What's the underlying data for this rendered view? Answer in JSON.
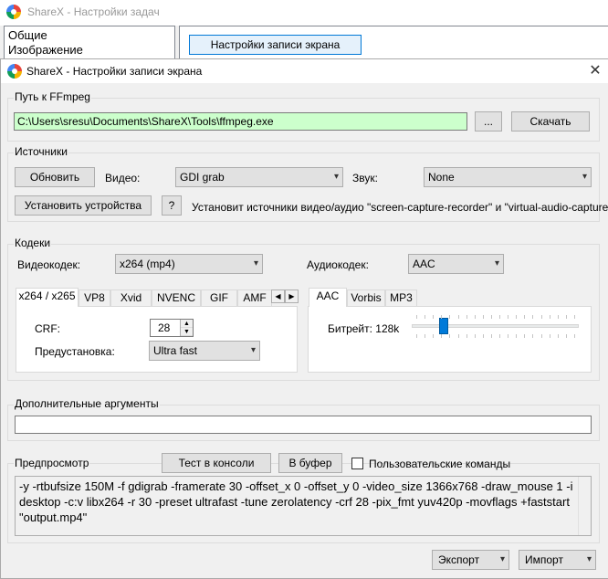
{
  "parent_window": {
    "title": "ShareX - Настройки задач",
    "sidebar_items": [
      "Общие",
      "Изображение"
    ],
    "screen_recording_button": "Настройки записи экрана"
  },
  "dialog": {
    "title": "ShareX - Настройки записи экрана",
    "close_glyph": "✕",
    "ffmpeg": {
      "group_label": "Путь к FFmpeg",
      "path_value": "C:\\Users\\sresu\\Documents\\ShareX\\Tools\\ffmpeg.exe",
      "browse_label": "...",
      "download_label": "Скачать"
    },
    "sources": {
      "group_label": "Источники",
      "refresh_label": "Обновить",
      "video_label": "Видео:",
      "video_value": "GDI grab",
      "audio_label": "Звук:",
      "audio_value": "None",
      "install_label": "Установить устройства",
      "help_label": "?",
      "install_hint": "Установит источники видео/аудио \"screen-capture-recorder\" и \"virtual-audio-capturer\""
    },
    "codecs": {
      "group_label": "Кодеки",
      "video_codec_label": "Видеокодек:",
      "video_codec_value": "x264 (mp4)",
      "audio_codec_label": "Аудиокодек:",
      "audio_codec_value": "AAC",
      "video_tabs": [
        "x264 / x265",
        "VP8",
        "Xvid",
        "NVENC",
        "GIF",
        "AMF"
      ],
      "audio_tabs": [
        "AAC",
        "Vorbis",
        "MP3"
      ],
      "crf_label": "CRF:",
      "crf_value": "28",
      "preset_label": "Предустановка:",
      "preset_value": "Ultra fast",
      "bitrate_label": "Битрейт: 128k",
      "bitrate_level": 0.19
    },
    "extra_args": {
      "group_label": "Дополнительные аргументы",
      "value": ""
    },
    "preview": {
      "group_label": "Предпросмотр",
      "test_console_label": "Тест в консоли",
      "to_clipboard_label": "В буфер",
      "custom_commands_label": "Пользовательские команды",
      "custom_commands_checked": false,
      "command_text": "-y -rtbufsize 150M -f gdigrab -framerate 30 -offset_x 0 -offset_y 0 -video_size 1366x768 -draw_mouse 1 -i desktop -c:v libx264 -r 30 -preset ultrafast -tune zerolatency -crf 28 -pix_fmt yuv420p -movflags +faststart \"output.mp4\""
    },
    "footer": {
      "export_label": "Экспорт",
      "import_label": "Импорт"
    }
  },
  "icons": {
    "chevron_down": "▾",
    "spin_up": "▲",
    "spin_down": "▼",
    "scroll_left": "◀",
    "scroll_right": "▶"
  },
  "colors": {
    "path_field_bg": "#ccffcc",
    "accent": "#0078d7",
    "slider_thumb": "#007ad9"
  }
}
